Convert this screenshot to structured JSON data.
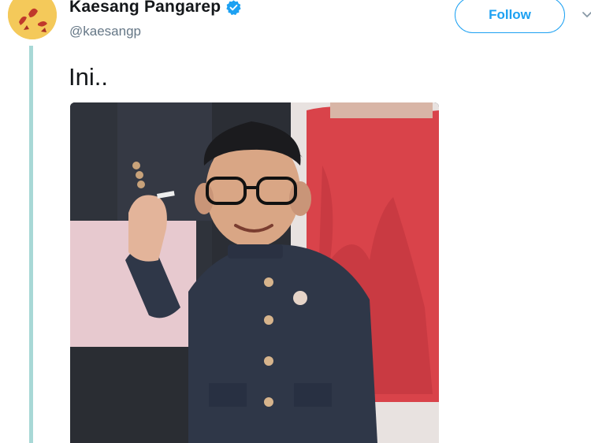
{
  "tweet": {
    "author": {
      "display_name": "Kaesang Pangarep",
      "handle": "@kaesangp",
      "verified": true,
      "avatar_icon": "avatar-illustration"
    },
    "follow_label": "Follow",
    "text": "Ini..",
    "media": {
      "type": "photo",
      "description_icon": "photo-edited-man-in-black-jacket"
    }
  },
  "colors": {
    "accent": "#1da1f2",
    "thread_line": "#a8d8d6",
    "name_text": "#14171a",
    "handle_text": "#657786",
    "avatar_bg": "#f4c95a"
  }
}
